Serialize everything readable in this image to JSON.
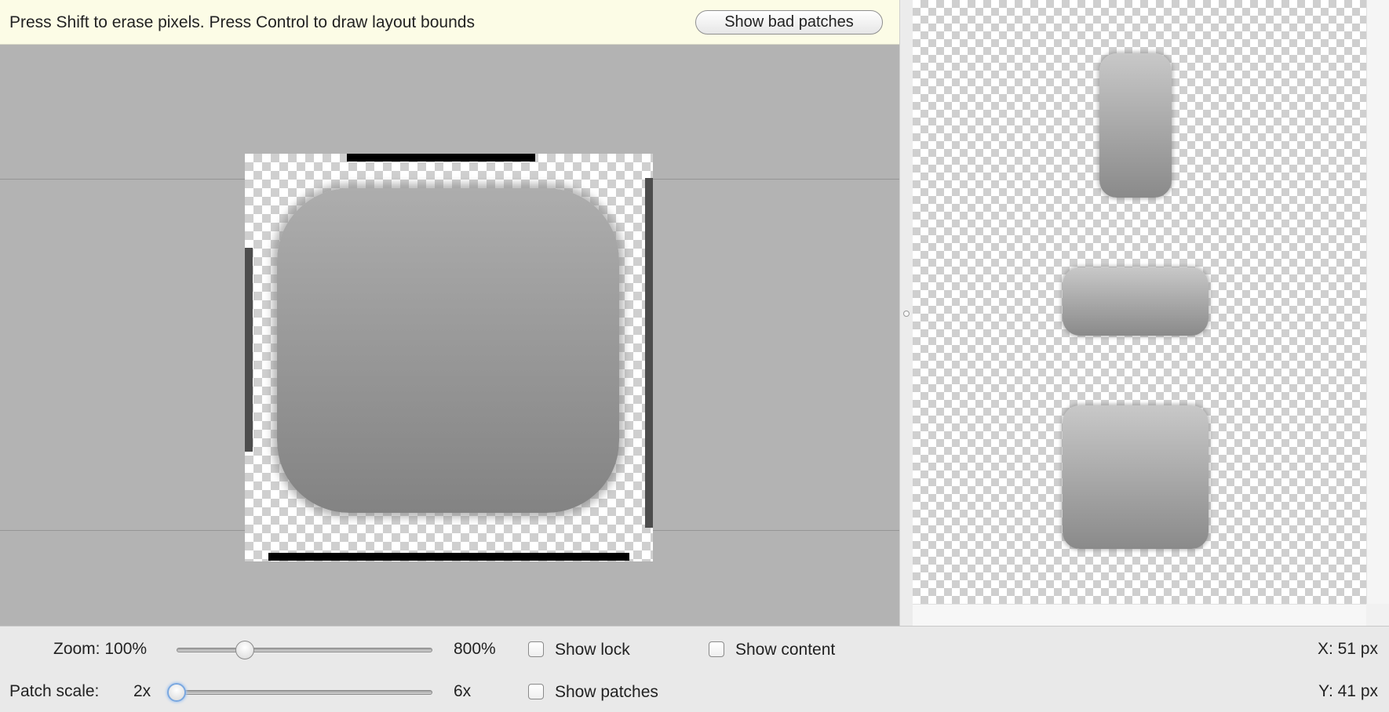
{
  "hint": {
    "text": "Press Shift to erase pixels. Press Control to draw layout bounds",
    "bad_patches_label": "Show bad patches"
  },
  "controls": {
    "zoom_label": "Zoom: 100%",
    "zoom_max_label": "800%",
    "zoom_value_percent": 100,
    "patch_scale_label": "Patch scale:",
    "patch_scale_min_label": "2x",
    "patch_scale_max_label": "6x",
    "patch_scale_value": 2,
    "show_lock_label": "Show lock",
    "show_lock_checked": false,
    "show_patches_label": "Show patches",
    "show_patches_checked": false,
    "show_content_label": "Show content",
    "show_content_checked": false
  },
  "status": {
    "x_label": "X: 51 px",
    "y_label": "Y: 41 px"
  },
  "colors": {
    "canvas_background": "#b3b3b3",
    "hint_background": "#fcfce6",
    "patch_marker": "#000000",
    "content_marker": "#4d4d4d",
    "slider_focus": "#7aa8e0"
  },
  "icons": {
    "split_handle": "split-pane-handle-icon"
  }
}
